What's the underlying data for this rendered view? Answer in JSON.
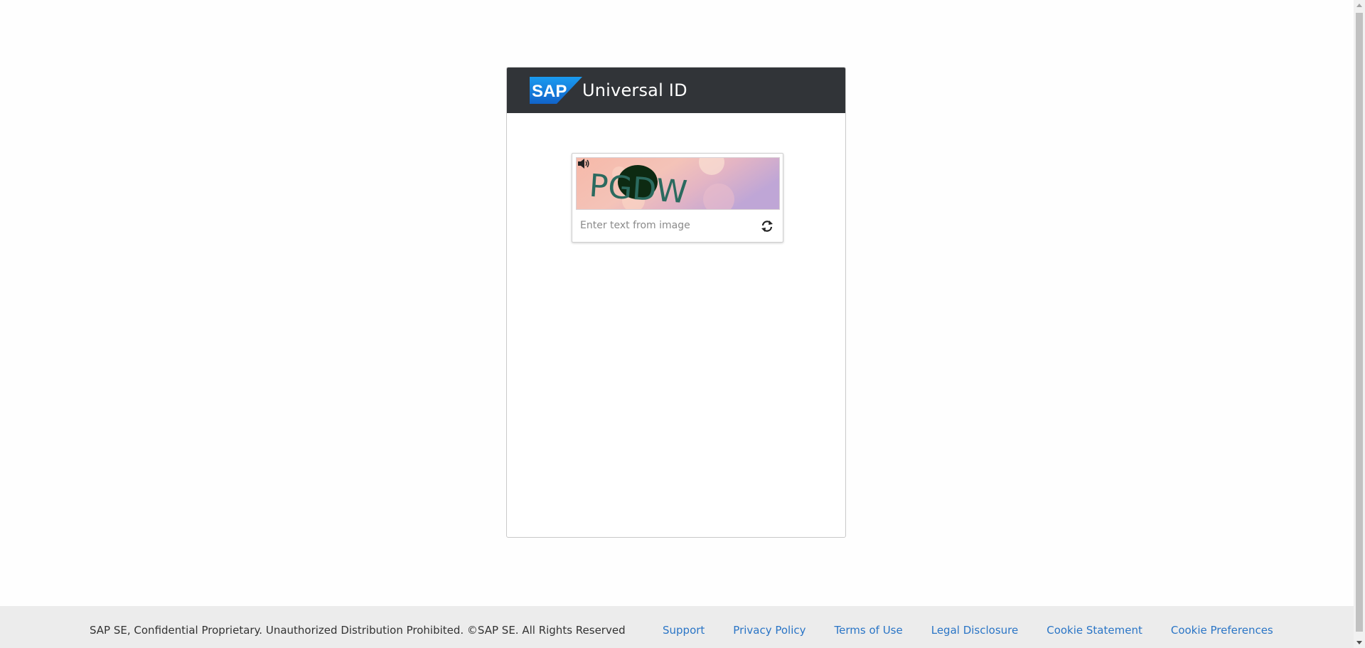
{
  "header": {
    "logo_text": "SAP",
    "title": "Universal ID"
  },
  "captcha": {
    "image_text": "PGDW",
    "input_placeholder": "Enter text from image",
    "input_value": "",
    "audio_icon": "speaker-icon",
    "refresh_icon": "refresh-icon"
  },
  "footer": {
    "copyright": "SAP SE, Confidential Proprietary. Unauthorized Distribution Prohibited. ©SAP SE. All Rights Reserved",
    "links": [
      "Support",
      "Privacy Policy",
      "Terms of Use",
      "Legal Disclosure",
      "Cookie Statement",
      "Cookie Preferences"
    ]
  },
  "colors": {
    "header_bg": "#313438",
    "link": "#2a75c6",
    "footer_bg": "#ececec",
    "sap_blue": "#1873d4"
  }
}
